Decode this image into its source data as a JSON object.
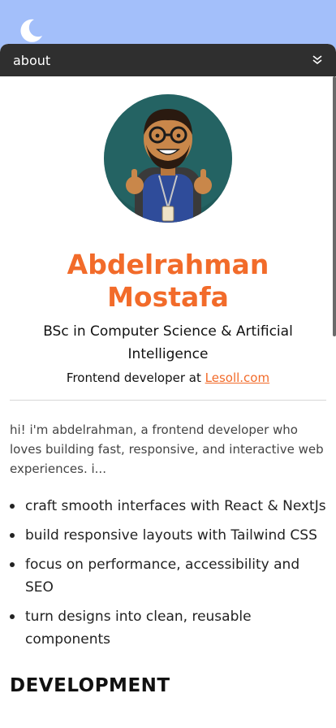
{
  "theme": {
    "accent": "#f26b2a",
    "bg": "#a3bffa",
    "titlebar": "#2f2f2f"
  },
  "header": {
    "theme_toggle_icon": "moon-icon"
  },
  "window": {
    "title": "about",
    "collapse_icon": "double-chevron-down-icon"
  },
  "profile": {
    "avatar_icon": "avatar-illustration",
    "name": "Abdelrahman Mostafa",
    "degree": "BSc in Computer Science & Artificial Intelligence",
    "role_prefix": "Frontend developer at",
    "company": "Lesoll.com"
  },
  "intro": "hi! i'm abdelrahman, a frontend developer who loves building fast, responsive, and interactive web experiences. i...",
  "skills": [
    "craft smooth interfaces with React & NextJs",
    "build responsive layouts with Tailwind CSS",
    "focus on performance, accessibility and SEO",
    "turn designs into clean, reusable components"
  ],
  "sections": {
    "development": "DEVELOPMENT"
  }
}
